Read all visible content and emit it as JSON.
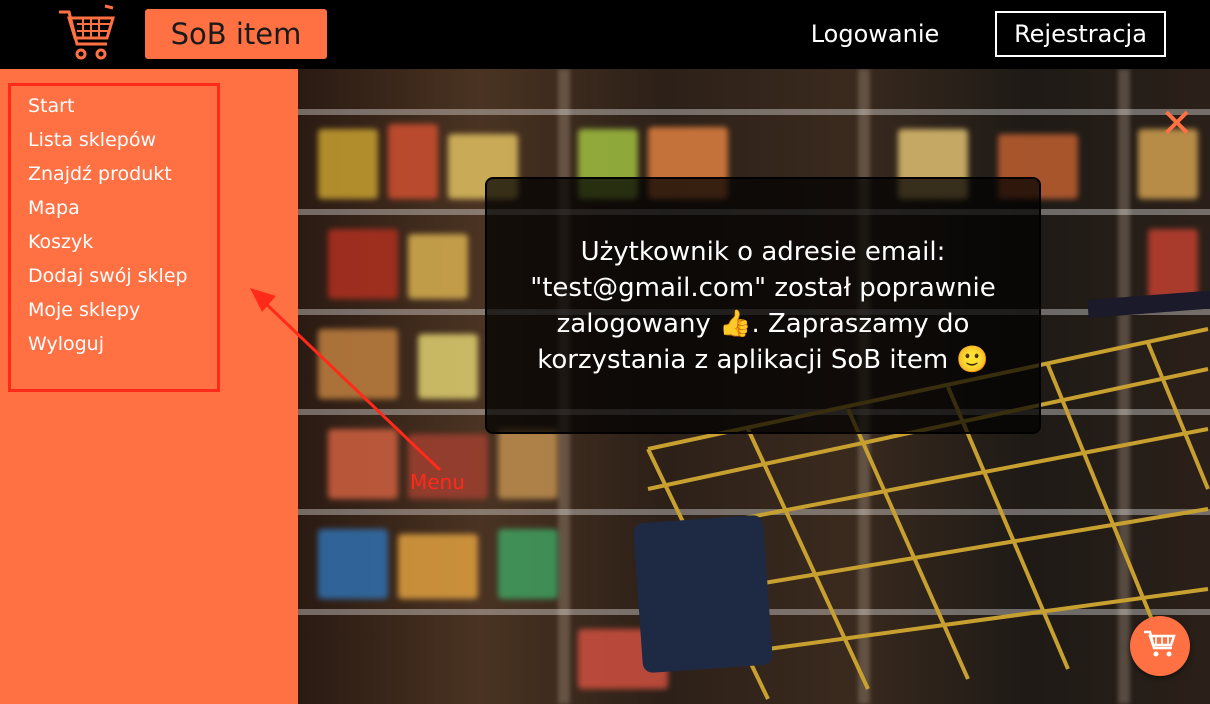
{
  "header": {
    "logo_icon": "shopping-cart-icon",
    "brand_label": "SoB item",
    "login_label": "Logowanie",
    "register_label": "Rejestracja"
  },
  "colors": {
    "accent": "#ff7043",
    "annotation": "#ff2a1a",
    "topbar": "#000000"
  },
  "sidebar": {
    "items": [
      {
        "label": "Start"
      },
      {
        "label": "Lista sklepów"
      },
      {
        "label": "Znajdź produkt"
      },
      {
        "label": "Mapa"
      },
      {
        "label": "Koszyk"
      },
      {
        "label": "Dodaj swój sklep"
      },
      {
        "label": "Moje sklepy"
      },
      {
        "label": "Wyloguj"
      }
    ]
  },
  "modal": {
    "message": "Użytkownik o adresie email: \"test@gmail.com\" został poprawnie zalogowany 👍. Zapraszamy do korzystania z aplikacji SoB item 🙂",
    "close_icon": "close-icon"
  },
  "annotation": {
    "label": "Menu"
  },
  "fab": {
    "icon": "shopping-cart-icon"
  }
}
